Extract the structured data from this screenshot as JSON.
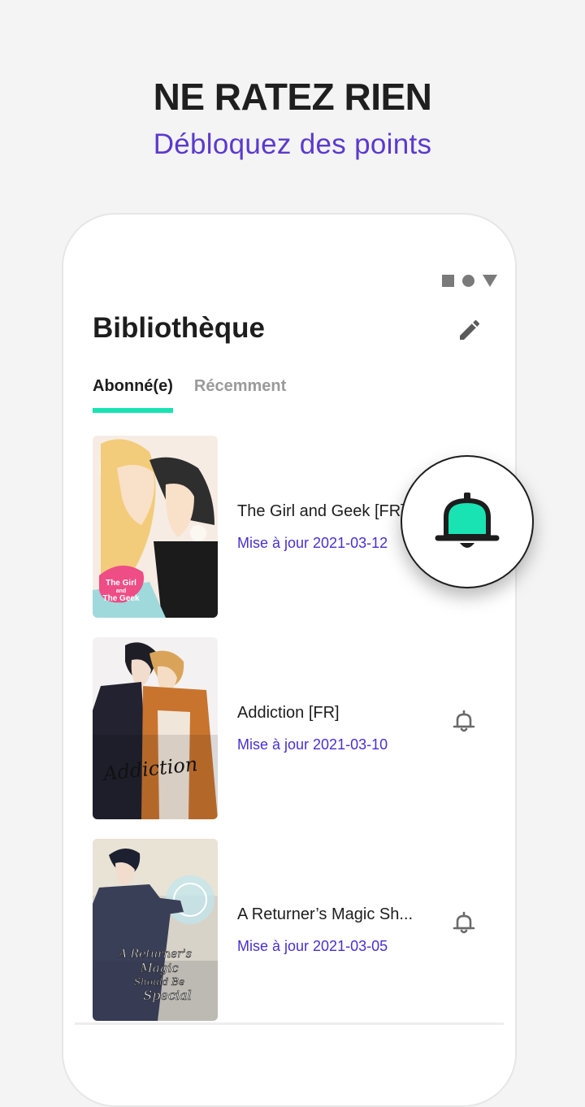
{
  "promo": {
    "title": "NE RATEZ RIEN",
    "subtitle": "Débloquez des points",
    "accent_color": "#5b3ad0"
  },
  "status_bar": {
    "icons": [
      "square-icon",
      "circle-icon",
      "triangle-icon"
    ]
  },
  "library": {
    "title": "Bibliothèque",
    "edit_icon": "pencil-icon"
  },
  "tabs": [
    {
      "label": "Abonné(e)",
      "active": true
    },
    {
      "label": "Récemment",
      "active": false
    }
  ],
  "tab_indicator_color": "#19e3b2",
  "comics": [
    {
      "title": "The Girl and Geek [FR]",
      "updated": "Mise à jour 2021-03-12",
      "cover_text": [
        "The Girl",
        "and",
        "The Geek"
      ],
      "notification": "bell-filled-icon"
    },
    {
      "title": "Addiction [FR]",
      "updated": "Mise à jour 2021-03-10",
      "cover_text": [
        "Addiction"
      ],
      "notification": "bell-outline-icon"
    },
    {
      "title": "A Returner’s Magic Sh...",
      "updated": "Mise à jour 2021-03-05",
      "cover_text": [
        "A Returner's",
        "Magic",
        "Should Be",
        "Special"
      ],
      "notification": "bell-outline-icon"
    }
  ],
  "highlight_bell": {
    "icon": "bell-filled-icon",
    "color": "#19e3b2"
  }
}
